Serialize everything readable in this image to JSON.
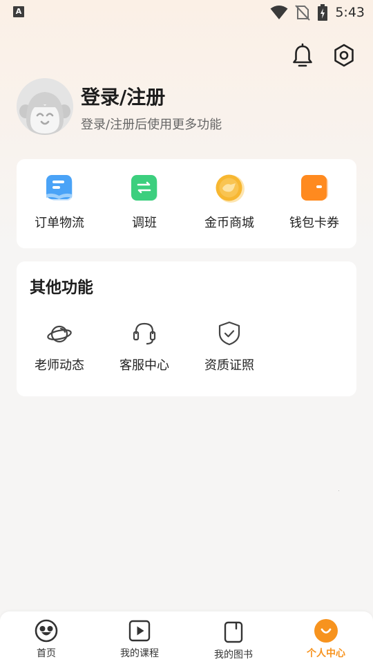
{
  "status_bar": {
    "notification_letter": "A",
    "time": "5:43",
    "icons": [
      "wifi-icon",
      "no-sim-icon",
      "battery-charging-icon"
    ]
  },
  "header": {
    "icons": [
      "bell-icon",
      "settings-hexagon-icon"
    ]
  },
  "profile": {
    "title": "登录/注册",
    "subtitle": "登录/注册后使用更多功能"
  },
  "quick_actions": {
    "items": [
      {
        "label": "订单物流",
        "icon": "order-logistics-icon",
        "color": "#4aa3f7"
      },
      {
        "label": "调班",
        "icon": "swap-class-icon",
        "color": "#3ccf7e"
      },
      {
        "label": "金币商城",
        "icon": "coin-mall-icon",
        "color": "#f7b731"
      },
      {
        "label": "钱包卡券",
        "icon": "wallet-icon",
        "color": "#ff8a1f"
      }
    ]
  },
  "other_functions": {
    "title": "其他功能",
    "items": [
      {
        "label": "老师动态",
        "icon": "planet-icon"
      },
      {
        "label": "客服中心",
        "icon": "headset-icon"
      },
      {
        "label": "资质证照",
        "icon": "shield-check-icon"
      }
    ]
  },
  "bottom_nav": {
    "items": [
      {
        "label": "首页",
        "icon": "home-monkey-icon",
        "active": false
      },
      {
        "label": "我的课程",
        "icon": "play-course-icon",
        "active": false
      },
      {
        "label": "我的图书",
        "icon": "book-icon",
        "active": false
      },
      {
        "label": "个人中心",
        "icon": "smile-profile-icon",
        "active": true
      }
    ],
    "active_color": "#f7931e"
  }
}
